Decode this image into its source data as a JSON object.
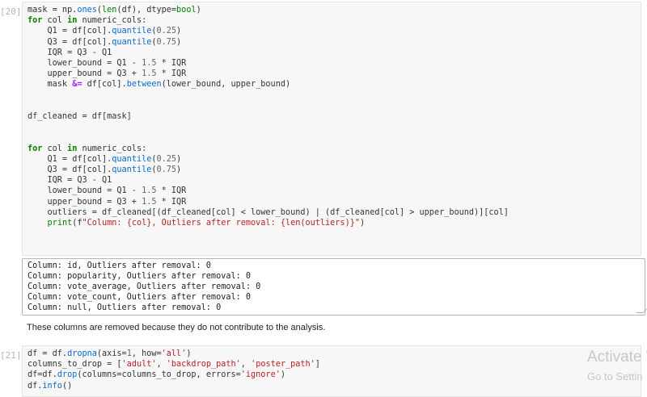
{
  "cells": [
    {
      "prompt": "[20]:",
      "lines": [
        "mask = np.ones(len(df), dtype=bool)",
        "for col in numeric_cols:",
        "    Q1 = df[col].quantile(0.25)",
        "    Q3 = df[col].quantile(0.75)",
        "    IQR = Q3 - Q1",
        "    lower_bound = Q1 - 1.5 * IQR",
        "    upper_bound = Q3 + 1.5 * IQR",
        "    mask &= df[col].between(lower_bound, upper_bound)",
        "",
        "",
        "df_cleaned = df[mask]",
        "",
        "",
        "for col in numeric_cols:",
        "    Q1 = df[col].quantile(0.25)",
        "    Q3 = df[col].quantile(0.75)",
        "    IQR = Q3 - Q1",
        "    lower_bound = Q1 - 1.5 * IQR",
        "    upper_bound = Q3 + 1.5 * IQR",
        "    outliers = df_cleaned[(df_cleaned[col] < lower_bound) | (df_cleaned[col] > upper_bound)][col]",
        "    print(f\"Column: {col}, Outliers after removal: {len(outliers)}\")"
      ]
    },
    {
      "prompt": "[21]:",
      "lines": [
        "df = df.dropna(axis=1, how='all')",
        "columns_to_drop = ['adult', 'backdrop_path', 'poster_path']",
        "df=df.drop(columns=columns_to_drop, errors='ignore')",
        "df.info()"
      ]
    }
  ],
  "output_lines": [
    "Column: id, Outliers after removal: 0",
    "Column: popularity, Outliers after removal: 0",
    "Column: vote_average, Outliers after removal: 0",
    "Column: vote_count, Outliers after removal: 0",
    "Column: null, Outliers after removal: 0"
  ],
  "markdown": "These columns are removed because they do not contribute to the analysis.",
  "watermark": {
    "title": "Activate W",
    "subtitle": "Go to Settin"
  }
}
